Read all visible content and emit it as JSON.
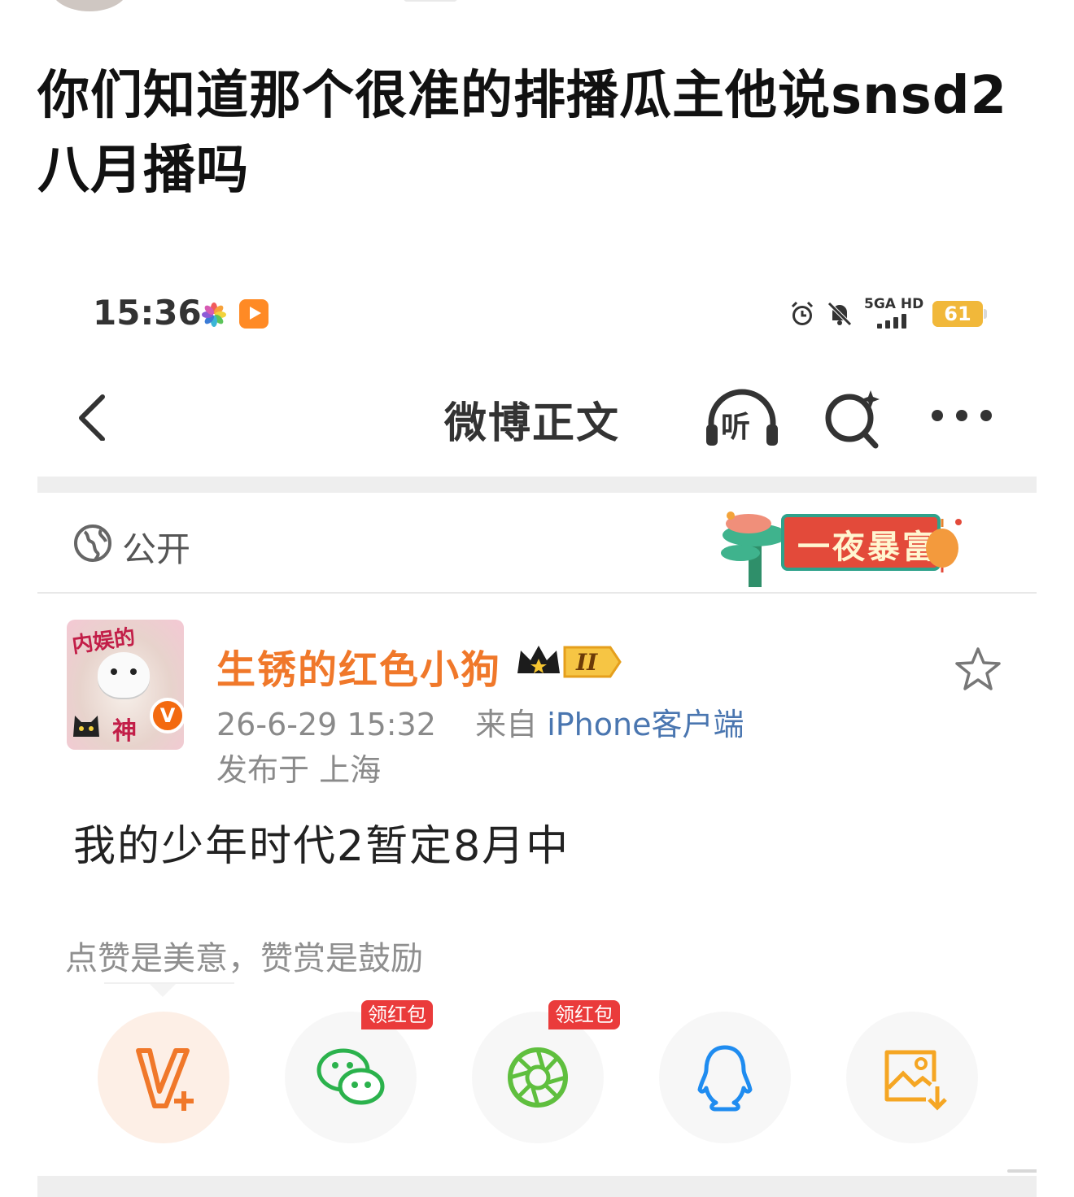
{
  "post": {
    "title": "你们知道那个很准的排播瓜主他说snsd2八月播吗"
  },
  "status_bar": {
    "time": "15:36",
    "network": "5GA HD",
    "battery": "61",
    "battery_level": 0.61
  },
  "nav": {
    "title": "微博正文",
    "listen_label": "听"
  },
  "visibility": {
    "label": "公开",
    "banner_text": "一夜暴富"
  },
  "author": {
    "avatar_top_text": "内娱的",
    "avatar_bottom_text": "神",
    "verified_mark": "V",
    "name": "生锈的红色小狗",
    "level": "II",
    "timestamp": "26-6-29 15:32",
    "source_prefix": "来自",
    "source": "iPhone客户端",
    "location": "发布于 上海"
  },
  "content": {
    "text": "我的少年时代2暂定8月中"
  },
  "reward": {
    "label": "点赞是美意，赞赏是鼓励"
  },
  "share": {
    "wechat_tag": "领红包",
    "moments_tag": "领红包"
  },
  "colors": {
    "accent_orange": "#f0782a",
    "source_blue": "#4a76b0",
    "red_tag": "#ea3b3b",
    "wechat_green": "#2bb24c",
    "qq_blue": "#1f8cf0"
  }
}
